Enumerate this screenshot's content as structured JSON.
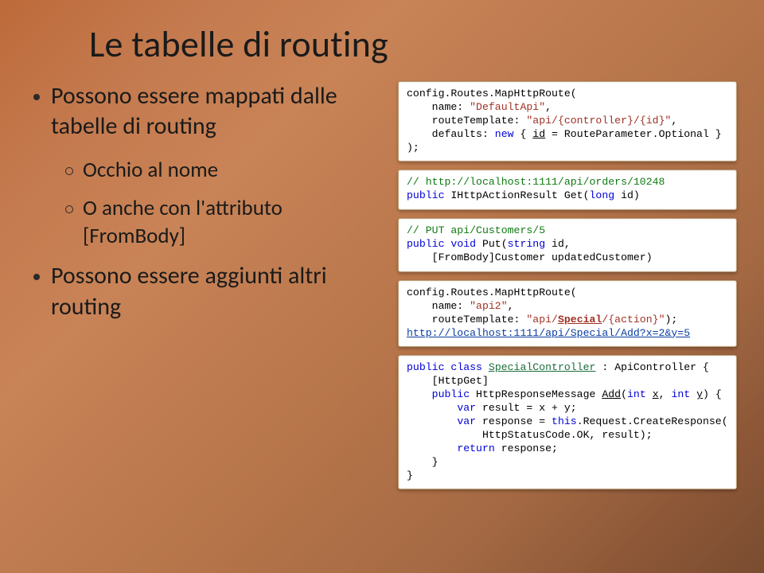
{
  "title": "Le tabelle di routing",
  "left": {
    "b1": "Possono essere mappati dalle tabelle di routing",
    "s1": "Occhio al nome",
    "s2": "O anche con l'attributo [FromBody]",
    "b2": "Possono essere aggiunti altri routing"
  },
  "code1": {
    "l1a": "config.Routes.MapHttpRoute(",
    "l2a": "    name: ",
    "l2b": "\"DefaultApi\"",
    "l2c": ",",
    "l3a": "    routeTemplate: ",
    "l3b": "\"api/{controller}/{id}\"",
    "l3c": ",",
    "l4a": "    defaults: ",
    "l4b": "new",
    "l4c": " { ",
    "l4d": "id",
    "l4e": " = RouteParameter.Optional }",
    "l5": ");"
  },
  "code2": {
    "l1": "// http://localhost:1111/api/orders/10248",
    "l2a": "public",
    "l2b": " IHttpActionResult Get(",
    "l2c": "long",
    "l2d": " id)"
  },
  "code3": {
    "l1": "// PUT api/Customers/5",
    "l2a": "public",
    "l2b": " ",
    "l2c": "void",
    "l2d": " Put(",
    "l2e": "string",
    "l2f": " id,",
    "l3a": "    [FromBody]Customer updatedCustomer)"
  },
  "code4": {
    "l1a": "config.Routes.MapHttpRoute(",
    "l2a": "    name: ",
    "l2b": "\"api2\"",
    "l2c": ",",
    "l3a": "    routeTemplate: ",
    "l3b": "\"api/",
    "l3c": "Special",
    "l3d": "/{action}\"",
    "l3e": ");",
    "l4": "http://localhost:1111/api/Special/Add?x=2&y=5"
  },
  "code5": {
    "l1a": "public",
    "l1b": " ",
    "l1c": "class",
    "l1d": " ",
    "l1e": "SpecialController",
    "l1f": " : ApiController {",
    "l2a": "    [HttpGet]",
    "l3a": "    ",
    "l3b": "public",
    "l3c": " HttpResponseMessage ",
    "l3d": "Add",
    "l3e": "(",
    "l3f": "int",
    "l3g": " ",
    "l3h": "x",
    "l3i": ", ",
    "l3j": "int",
    "l3k": " ",
    "l3l": "y",
    "l3m": ") {",
    "l4a": "        ",
    "l4b": "var",
    "l4c": " result = x + y;",
    "l5a": "        ",
    "l5b": "var",
    "l5c": " response = ",
    "l5d": "this",
    "l5e": ".Request.CreateResponse(",
    "l6a": "            HttpStatusCode.OK, result);",
    "l7a": "        ",
    "l7b": "return",
    "l7c": " response;",
    "l8a": "    }",
    "l9a": "}"
  }
}
